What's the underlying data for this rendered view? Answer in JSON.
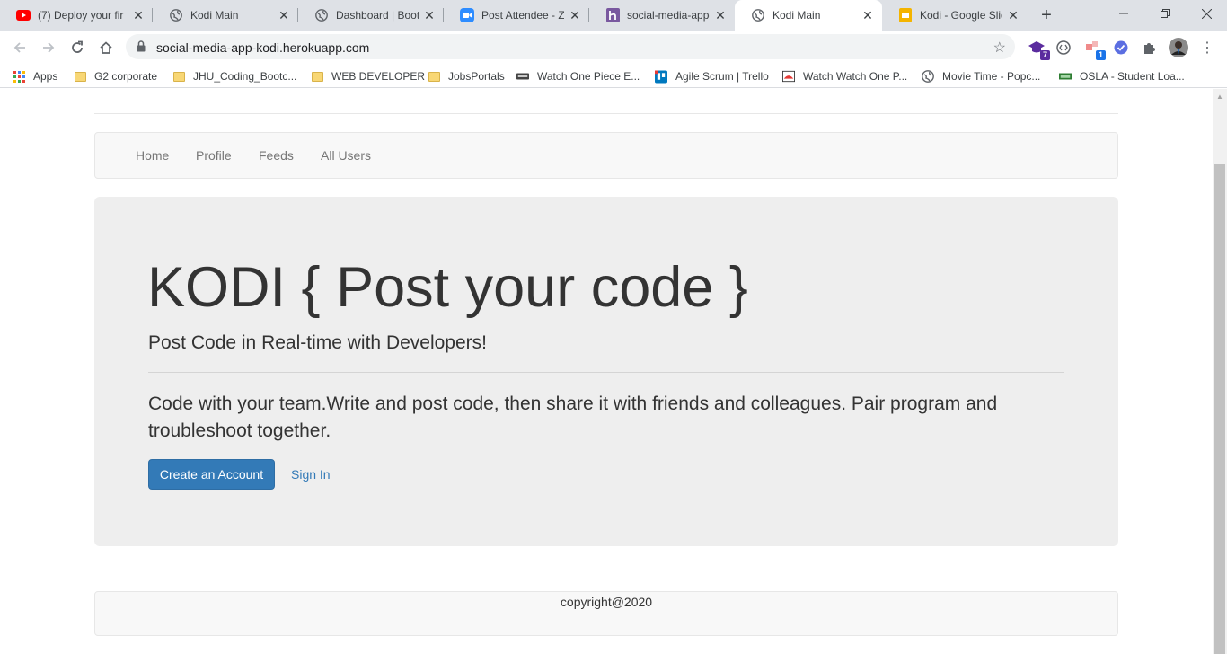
{
  "browser": {
    "tabs": [
      {
        "title": "(7) Deploy your fir",
        "icon": "youtube-icon"
      },
      {
        "title": "Kodi Main",
        "icon": "globe-icon"
      },
      {
        "title": "Dashboard | Bootc",
        "icon": "globe-icon"
      },
      {
        "title": "Post Attendee - Zo",
        "icon": "zoom-icon"
      },
      {
        "title": "social-media-app-",
        "icon": "heroku-icon"
      },
      {
        "title": "Kodi Main",
        "icon": "globe-icon",
        "active": true
      },
      {
        "title": "Kodi - Google Slid",
        "icon": "google-slides-icon"
      }
    ],
    "new_tab_label": "+",
    "url": "social-media-app-kodi.herokuapp.com",
    "extension_badges": {
      "ext1": "7",
      "ext3": "1"
    },
    "bookmarks": [
      {
        "label": "Apps",
        "icon": "apps-grid-icon"
      },
      {
        "label": "G2 corporate",
        "icon": "folder-icon"
      },
      {
        "label": "JHU_Coding_Bootc...",
        "icon": "folder-icon"
      },
      {
        "label": "WEB DEVELOPER",
        "icon": "folder-icon"
      },
      {
        "label": "JobsPortals",
        "icon": "folder-icon"
      },
      {
        "label": "Watch One Piece E...",
        "icon": "site-icon"
      },
      {
        "label": "Agile Scrum | Trello",
        "icon": "trello-icon"
      },
      {
        "label": "Watch Watch One P...",
        "icon": "site-icon"
      },
      {
        "label": "Movie Time - Popc...",
        "icon": "globe-icon"
      },
      {
        "label": "OSLA - Student Loa...",
        "icon": "site-icon"
      }
    ]
  },
  "page": {
    "nav": [
      "Home",
      "Profile",
      "Feeds",
      "All Users"
    ],
    "hero": {
      "title": "KODI { Post your code }",
      "lead": "Post Code in Real-time with Developers!",
      "body": "Code with your team.Write and post code, then share it with friends and colleagues. Pair program and troubleshoot together.",
      "create_label": "Create an Account",
      "signin_label": "Sign In"
    },
    "footer": "copyright@2020"
  },
  "colors": {
    "primary": "#337ab7",
    "jumbotron": "#eeeeee",
    "navbar": "#f8f8f8"
  }
}
